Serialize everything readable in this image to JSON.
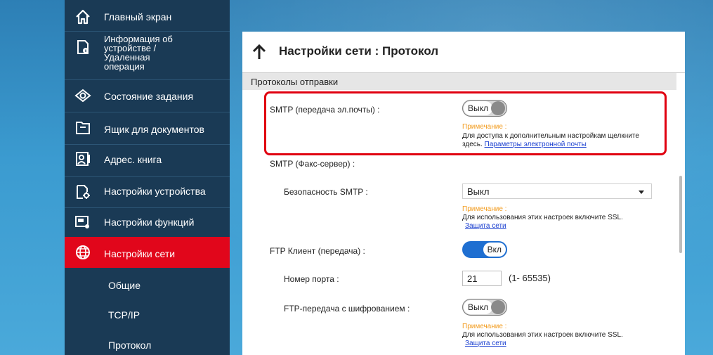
{
  "sidebar": {
    "items": [
      {
        "label": "Главный экран",
        "icon": "home-icon"
      },
      {
        "label": "Информация об устройстве / Удаленная операция",
        "icon": "device-info-icon"
      },
      {
        "label": "Состояние задания",
        "icon": "eye-icon"
      },
      {
        "label": "Ящик для документов",
        "icon": "document-box-icon"
      },
      {
        "label": "Адрес. книга",
        "icon": "address-book-icon"
      },
      {
        "label": "Настройки устройства",
        "icon": "device-settings-icon"
      },
      {
        "label": "Настройки функций",
        "icon": "function-settings-icon"
      },
      {
        "label": "Настройки сети",
        "icon": "globe-icon",
        "active": true
      }
    ],
    "subitems": [
      {
        "label": "Общие"
      },
      {
        "label": "TCP/IP"
      },
      {
        "label": "Протокол"
      }
    ],
    "info_lines": [
      "Информация об",
      "устройстве /",
      "Удаленная",
      "операция"
    ]
  },
  "panel": {
    "title": "Настройки сети : Протокол",
    "section_title": "Протоколы отправки",
    "smtp_email": {
      "label": "SMTP (передача эл.почты) :",
      "toggle": "Выкл",
      "note_title": "Примечание :",
      "note_text_1": "Для доступа к дополнительным настройкам щелкните",
      "note_text_2": "здесь.",
      "note_link": "Параметры электронной почты"
    },
    "smtp_fax": {
      "label": "SMTP (Факс-сервер) :"
    },
    "smtp_security": {
      "label": "Безопасность SMTP :",
      "value": "Выкл",
      "note_title": "Примечание :",
      "note_text": "Для использования этих настроек включите SSL.",
      "note_link": "Защита сети"
    },
    "ftp_client": {
      "label": "FTP Клиент (передача) :",
      "toggle": "Вкл"
    },
    "port": {
      "label": "Номер порта :",
      "value": "21",
      "range": "(1- 65535)"
    },
    "ftp_encrypt": {
      "label": "FTP-передача с шифрованием :",
      "toggle": "Выкл",
      "note_title": "Примечание :",
      "note_text": "Для использования этих настроек включите SSL.",
      "note_link": "Защита сети"
    }
  },
  "colors": {
    "sidebar_bg": "#1a3a55",
    "active_bg": "#e1061b",
    "note_orange": "#f29b1d",
    "toggle_on": "#1f6fd1",
    "highlight_red": "#e00010"
  }
}
